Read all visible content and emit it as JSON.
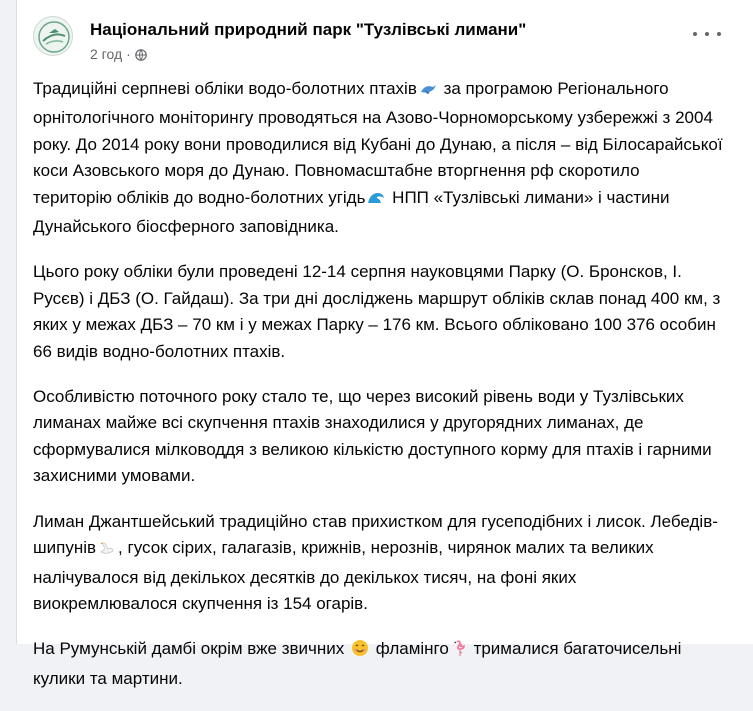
{
  "post": {
    "page_name": "Національний природний парк \"Тузлівські лимани\"",
    "time": "2 год",
    "separator": "·",
    "paragraphs": [
      {
        "t1": "Традиційні серпневі обліки водо-болотних птахів",
        "e1": "bird-icon",
        "t2": " за програмою Регіонального орнітологічного моніторингу проводяться на Азово-Чорноморському узбережжі з 2004 року. До 2014 року вони проводилися від Кубані до Дунаю, а після – від Білосарайської коси Азовського моря до Дунаю. Повномасштабне вторгнення рф скоротило територію обліків до водно-болотних угідь",
        "e2": "water-wave-icon",
        "t3": " НПП «Тузлівські лимани» і частини Дунайського біосферного заповідника."
      },
      {
        "t1": "Цього року обліки були проведені 12-14 серпня науковцями Парку (О. Бронсков, І. Русєв) і ДБЗ (О. Гайдаш). За три дні досліджень маршрут обліків склав понад 400 км, з яких у межах ДБЗ – 70 км і у межах Парку – 176 км. Всього обліковано 100 376 особин 66 видів водно-болотних птахів."
      },
      {
        "t1": "Особливістю поточного року стало те, що через високий рівень води у Тузлівських лиманах майже всі скупчення птахів знаходилися у другорядних лиманах, де сформувалися мілководдя з великою кількістю доступного корму для птахів і гарними захисними умовами."
      },
      {
        "t1": "Лиман Джантшейський традиційно став прихистком для гусеподібних і лисок. Лебедів-шипунів",
        "e1": "swan-icon",
        "t2": ", гусок сірих, галагазів, крижнів, нерознів, чирянок малих та великих налічувалося від декількох десятків до декількох тисяч, на фоні яких виокремлювалося скупчення із 154 огарів."
      },
      {
        "t1": "На Румунській дамбі окрім вже звичних ",
        "e1": "smiling-face-icon",
        "t2": " фламінго",
        "e2": "flamingo-icon",
        "t3": " трималися багаточисельні кулики та мартини."
      }
    ]
  },
  "colors": {
    "text": "#050505",
    "secondary": "#65676b",
    "background": "#f0f2f5",
    "card": "#ffffff"
  }
}
